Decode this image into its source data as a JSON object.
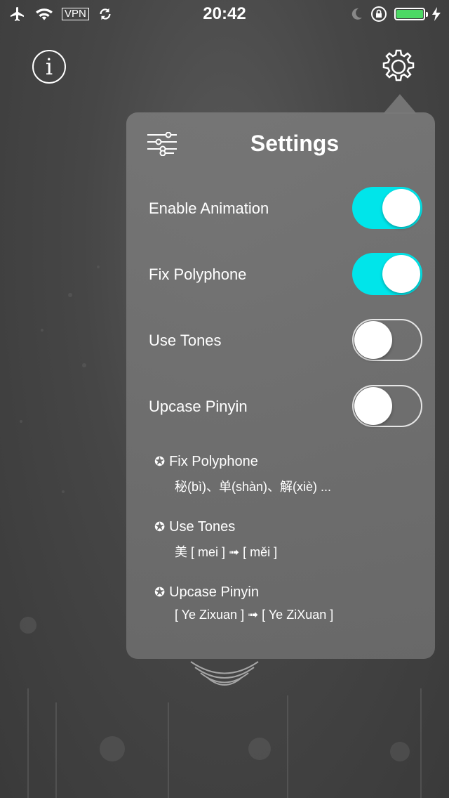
{
  "status_bar": {
    "time": "20:42",
    "vpn_label": "VPN",
    "battery_level": 1.0,
    "icons": [
      "airplane-icon",
      "wifi-icon",
      "sync-icon",
      "moon-icon",
      "orientation-lock-icon",
      "battery-icon",
      "charging-bolt-icon"
    ]
  },
  "header": {
    "info_glyph": "i"
  },
  "panel": {
    "title": "Settings",
    "settings": [
      {
        "label": "Enable Animation",
        "enabled": true
      },
      {
        "label": "Fix Polyphone",
        "enabled": true
      },
      {
        "label": "Use Tones",
        "enabled": false
      },
      {
        "label": "Upcase Pinyin",
        "enabled": false
      }
    ],
    "notes": [
      {
        "star": "✪",
        "title": "Fix Polyphone",
        "example": "秘(bì)、单(shàn)、解(xiè) ..."
      },
      {
        "star": "✪",
        "title": "Use Tones",
        "example": "美 [ mei ] ➟ [ měi ]"
      },
      {
        "star": "✪",
        "title": "Upcase Pinyin",
        "example": "[ Ye Zixuan ] ➟ [ Ye ZiXuan ]"
      }
    ]
  },
  "colors": {
    "toggle_on": "#00e5ea",
    "battery": "#4cd964",
    "background": "#464646",
    "panel": "#787878"
  }
}
